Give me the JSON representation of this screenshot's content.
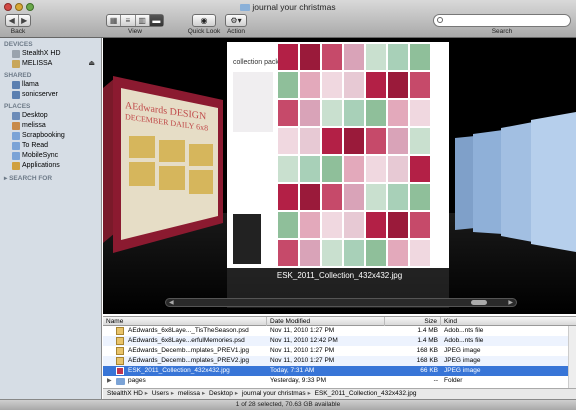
{
  "window": {
    "title": "journal your christmas"
  },
  "toolbar": {
    "back_label": "Back",
    "view_label": "View",
    "quicklook_label": "Quick Look",
    "action_label": "Action",
    "search_label": "Search"
  },
  "sidebar": {
    "devices_header": "DEVICES",
    "devices": [
      {
        "label": "StealthX HD"
      },
      {
        "label": "MELISSA"
      }
    ],
    "shared_header": "SHARED",
    "shared": [
      {
        "label": "llama"
      },
      {
        "label": "sonicserver"
      }
    ],
    "places_header": "PLACES",
    "places": [
      {
        "label": "Desktop"
      },
      {
        "label": "melissa"
      },
      {
        "label": "Scrapbooking"
      },
      {
        "label": "To Read"
      },
      {
        "label": "MobileSync"
      },
      {
        "label": "Applications"
      }
    ],
    "search_header": "SEARCH FOR"
  },
  "coverflow": {
    "caption": "ESK_2011_Collection_432x432.jpg",
    "left_cover_title": "AEdwards DESIGN",
    "left_cover_subtitle": "DECEMBER DAILY 6x8",
    "collection_title": "collection pack"
  },
  "list": {
    "columns": {
      "name": "Name",
      "date": "Date Modified",
      "size": "Size",
      "kind": "Kind"
    },
    "rows": [
      {
        "name": "AEdwards_6x8Laye..._TisTheSeason.psd",
        "date": "Nov 11, 2010 1:27 PM",
        "size": "1.4 MB",
        "kind": "Adob...nts file"
      },
      {
        "name": "AEdwards_6x8Laye...erfulMemories.psd",
        "date": "Nov 11, 2010 12:42 PM",
        "size": "1.4 MB",
        "kind": "Adob...nts file"
      },
      {
        "name": "AEdwards_Decemb...mplates_PREV1.jpg",
        "date": "Nov 11, 2010 1:27 PM",
        "size": "168 KB",
        "kind": "JPEG image"
      },
      {
        "name": "AEdwards_Decemb...mplates_PREV2.jpg",
        "date": "Nov 11, 2010 1:27 PM",
        "size": "168 KB",
        "kind": "JPEG image"
      },
      {
        "name": "ESK_2011_Collection_432x432.jpg",
        "date": "Today, 7:31 AM",
        "size": "66 KB",
        "kind": "JPEG image"
      },
      {
        "name": "pages",
        "date": "Yesterday, 9:33 PM",
        "size": "--",
        "kind": "Folder"
      }
    ]
  },
  "pathbar": {
    "crumbs": [
      "StealthX HD",
      "Users",
      "melissa",
      "Desktop",
      "journal your christmas",
      "ESK_2011_Collection_432x432.jpg"
    ]
  },
  "status": {
    "text": "1 of 28 selected, 70.63 GB available"
  },
  "colors": {
    "selection": "#3875d7",
    "sidebar_bg": "#d6dde5",
    "accent_red": "#b32046"
  }
}
